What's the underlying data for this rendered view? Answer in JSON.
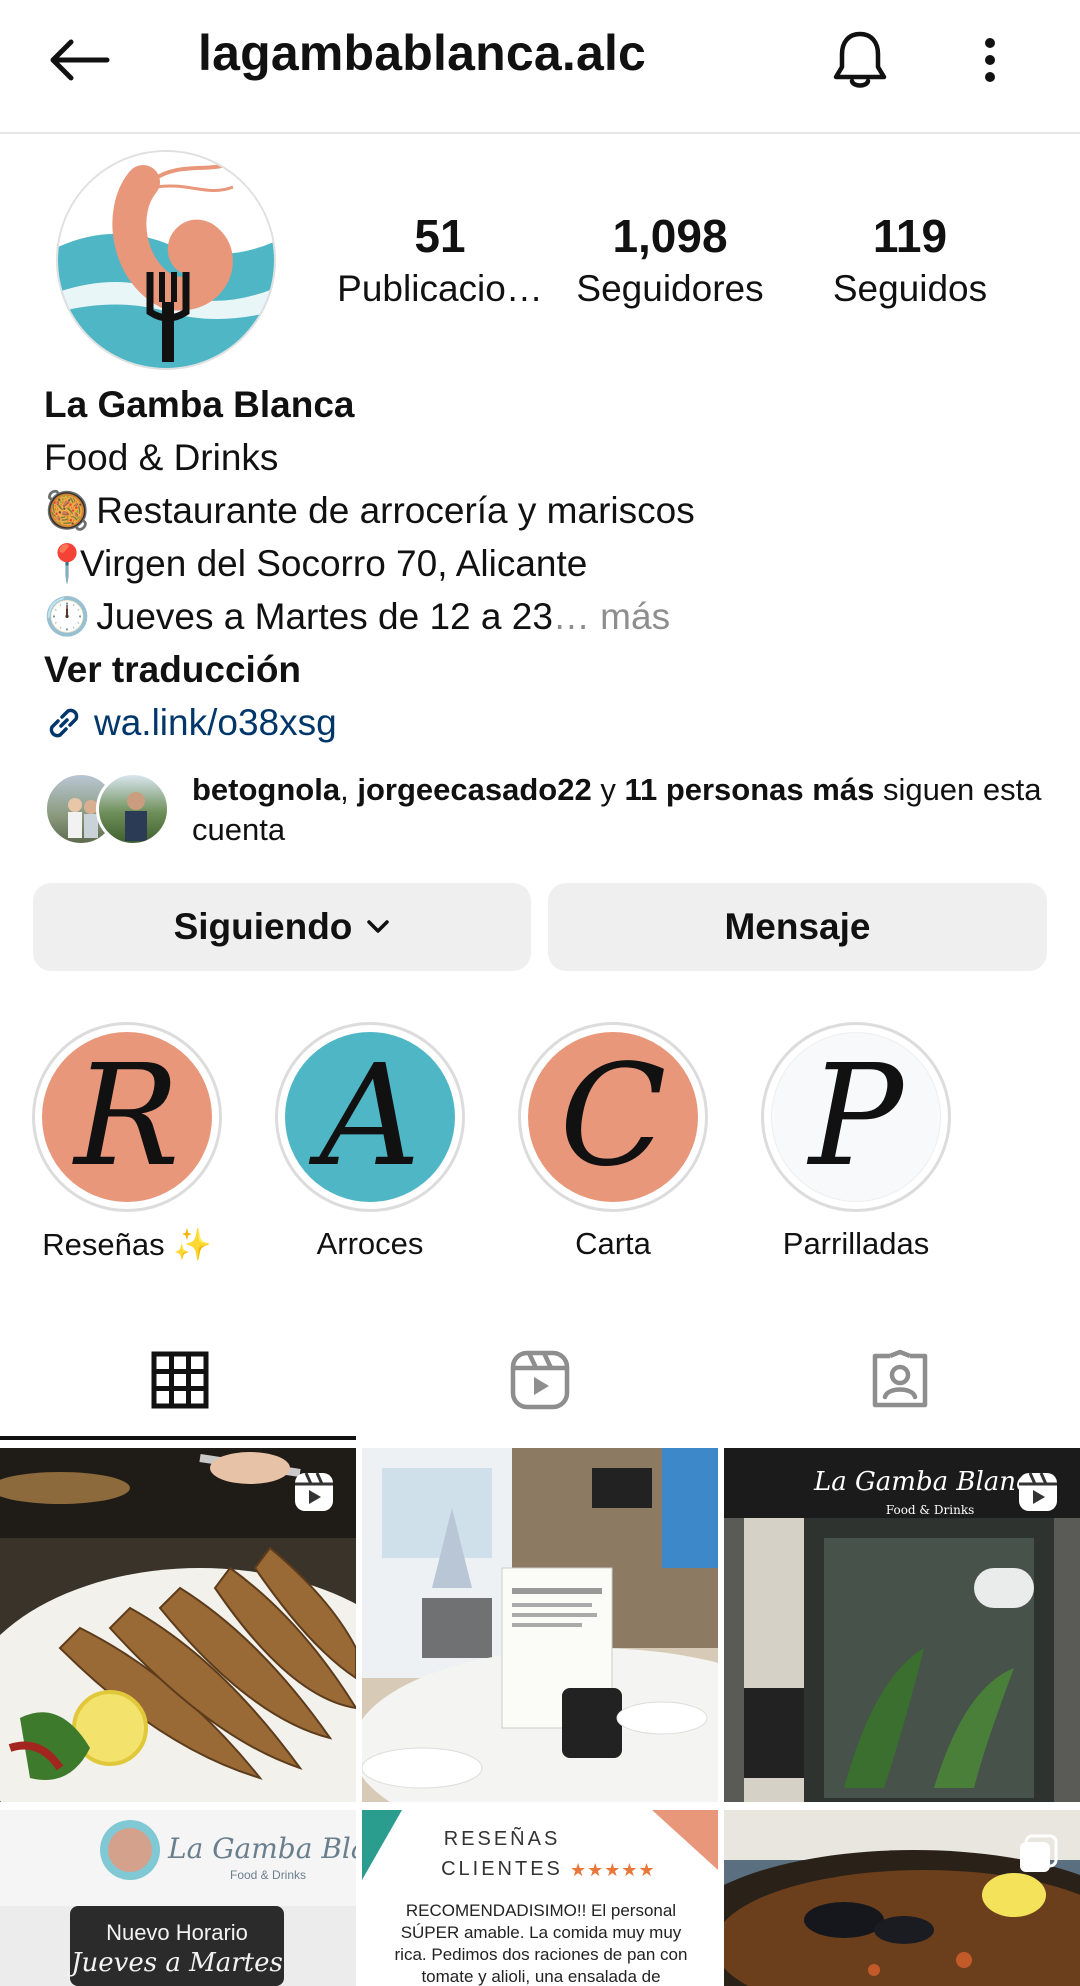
{
  "header": {
    "username": "lagambablanca.alc",
    "icons": [
      "back-arrow-icon",
      "bell-icon",
      "more-vertical-icon"
    ]
  },
  "stats": [
    {
      "value": "51",
      "label": "Publicacio…"
    },
    {
      "value": "1,098",
      "label": "Seguidores"
    },
    {
      "value": "119",
      "label": "Seguidos"
    }
  ],
  "bio": {
    "name": "La Gamba Blanca",
    "category": "Food & Drinks",
    "line1_emoji": "🥘",
    "line1": "Restaurante de arrocería y mariscos",
    "line2_emoji": "📍",
    "line2": "Virgen del Socorro 70, Alicante",
    "line3_emoji": "🕛",
    "line3": "Jueves a Martes de 12 a 23",
    "more": "… más",
    "translate": "Ver traducción",
    "link": "wa.link/o38xsg"
  },
  "followed_by": {
    "user1": "betognola",
    "sep": ", ",
    "user2": "jorgeecasado22",
    "and": " y ",
    "others": "11 personas más",
    "tail": " siguen esta cuenta"
  },
  "buttons": {
    "following": "Siguiendo",
    "message": "Mensaje"
  },
  "highlights": [
    {
      "letter": "R",
      "label": "Reseñas ✨",
      "color": "#e8977b"
    },
    {
      "letter": "A",
      "label": "Arroces",
      "color": "#4fb6c6"
    },
    {
      "letter": "C",
      "label": "Carta",
      "color": "#e8977b"
    },
    {
      "letter": "P",
      "label": "Parrilladas",
      "color": "#f7f9fb"
    }
  ],
  "tabs": [
    "grid-icon",
    "reels-icon",
    "tagged-icon"
  ],
  "posts": {
    "p5_title": "RESEÑAS CLIENTES",
    "p5_stars": "★★★★★",
    "p5_text": "RECOMENDADISIMO!! El personal SÚPER amable. La comida muy muy rica. Pedimos dos raciones de pan con tomate y alioli, una ensalada de",
    "p4_sign": "La Gamba Blanca",
    "p4_sub": "Food & Drinks",
    "p4_line1": "Nuevo Horario",
    "p4_line2": "Jueves a Martes",
    "p3_sign": "La Gamba Blanca",
    "p3_sub": "Food & Drinks"
  }
}
